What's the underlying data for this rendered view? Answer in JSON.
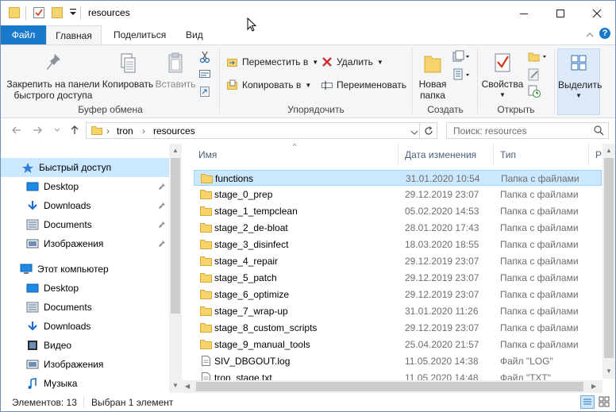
{
  "titlebar": {
    "title": "resources",
    "dropdown_glyph": "▾"
  },
  "tabs": {
    "file": "Файл",
    "home": "Главная",
    "share": "Поделиться",
    "view": "Вид"
  },
  "ribbon": {
    "pin": "Закрепить на панели быстрого доступа",
    "pin_l1": "Закрепить на панели",
    "pin_l2": "быстрого доступа",
    "copy": "Копировать",
    "paste": "Вставить",
    "clipboard_group": "Буфер обмена",
    "move_to": "Переместить в",
    "copy_to": "Копировать в",
    "delete": "Удалить",
    "rename": "Переименовать",
    "organize_group": "Упорядочить",
    "new_folder_l1": "Новая",
    "new_folder_l2": "папка",
    "create_group": "Создать",
    "properties": "Свойства",
    "open_group": "Открыть",
    "select": "Выделить"
  },
  "address": {
    "path": [
      "tron",
      "resources"
    ],
    "search_placeholder": "Поиск: resources"
  },
  "nav": {
    "quick_access": "Быстрый доступ",
    "quick_items": [
      "Desktop",
      "Downloads",
      "Documents",
      "Изображения"
    ],
    "this_pc": "Этот компьютер",
    "pc_items": [
      "Desktop",
      "Documents",
      "Downloads",
      "Видео",
      "Изображения",
      "Музыка"
    ]
  },
  "list": {
    "columns": {
      "name": "Имя",
      "date": "Дата изменения",
      "type": "Тип",
      "size": "Р"
    },
    "rows": [
      {
        "name": "functions",
        "date": "31.01.2020 10:54",
        "type": "Папка с файлами",
        "kind": "folder",
        "selected": true
      },
      {
        "name": "stage_0_prep",
        "date": "29.12.2019 23:07",
        "type": "Папка с файлами",
        "kind": "folder"
      },
      {
        "name": "stage_1_tempclean",
        "date": "05.02.2020 14:53",
        "type": "Папка с файлами",
        "kind": "folder"
      },
      {
        "name": "stage_2_de-bloat",
        "date": "28.01.2020 17:43",
        "type": "Папка с файлами",
        "kind": "folder"
      },
      {
        "name": "stage_3_disinfect",
        "date": "18.03.2020 18:55",
        "type": "Папка с файлами",
        "kind": "folder"
      },
      {
        "name": "stage_4_repair",
        "date": "29.12.2019 23:07",
        "type": "Папка с файлами",
        "kind": "folder"
      },
      {
        "name": "stage_5_patch",
        "date": "29.12.2019 23:07",
        "type": "Папка с файлами",
        "kind": "folder"
      },
      {
        "name": "stage_6_optimize",
        "date": "29.12.2019 23:07",
        "type": "Папка с файлами",
        "kind": "folder"
      },
      {
        "name": "stage_7_wrap-up",
        "date": "31.01.2020 11:26",
        "type": "Папка с файлами",
        "kind": "folder"
      },
      {
        "name": "stage_8_custom_scripts",
        "date": "29.12.2019 23:07",
        "type": "Папка с файлами",
        "kind": "folder"
      },
      {
        "name": "stage_9_manual_tools",
        "date": "25.04.2020 21:57",
        "type": "Папка с файлами",
        "kind": "folder"
      },
      {
        "name": "SIV_DBGOUT.log",
        "date": "11.05.2020 14:38",
        "type": "Файл \"LOG\"",
        "kind": "file"
      },
      {
        "name": "tron_stage.txt",
        "date": "11.05.2020 14:48",
        "type": "Файл \"TXT\"",
        "kind": "file"
      }
    ]
  },
  "status": {
    "items": "Элементов: 13",
    "selected": "Выбран 1 элемент"
  },
  "colors": {
    "accent": "#1979ca",
    "folder": "#f7d36b",
    "selection": "#cce8ff"
  }
}
